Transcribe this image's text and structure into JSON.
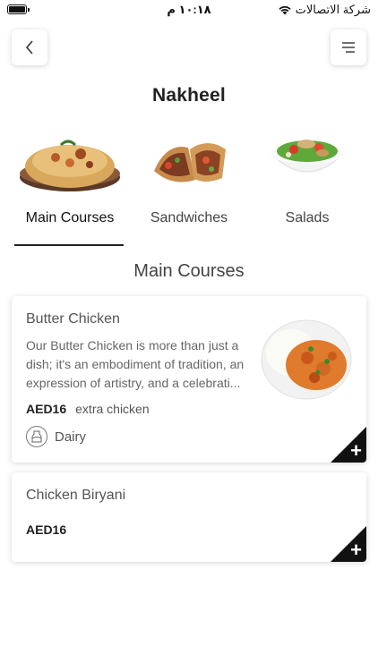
{
  "status_bar": {
    "carrier": "شركة الاتصالات",
    "time": "١٠:١٨ م"
  },
  "header": {
    "restaurant_name": "Nakheel",
    "back_icon": "chevron-left-icon",
    "menu_icon": "hamburger-menu-icon"
  },
  "categories": [
    {
      "label": "Main Courses",
      "active": true
    },
    {
      "label": "Sandwiches",
      "active": false
    },
    {
      "label": "Salads",
      "active": false
    }
  ],
  "section": {
    "title": "Main Courses"
  },
  "items": [
    {
      "name": "Butter Chicken",
      "description": "Our Butter Chicken is more than just a dish; it's an embodiment of tradition, an expression of artistry, and a celebrati...",
      "price": "AED16",
      "addon": "extra chicken",
      "tag": "Dairy"
    },
    {
      "name": "Chicken Biryani",
      "price": "AED16"
    }
  ],
  "colors": {
    "accent": "#111111",
    "text": "#222222",
    "muted": "#666666"
  }
}
